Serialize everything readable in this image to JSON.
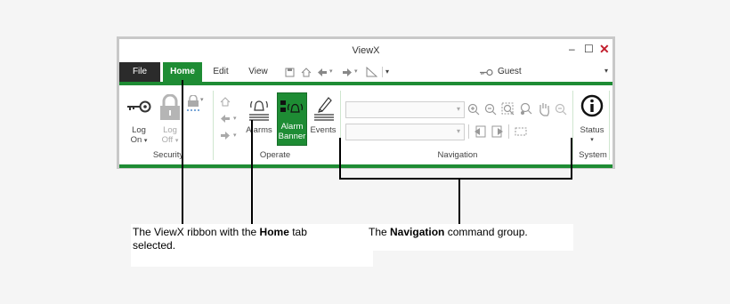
{
  "window": {
    "title": "ViewX",
    "minimize": "–",
    "maximize": "☐",
    "close": "✕"
  },
  "tabs": {
    "file": "File",
    "home": "Home",
    "edit": "Edit",
    "view": "View"
  },
  "user": {
    "name": "Guest",
    "dropdown": "▾"
  },
  "ribbon": {
    "security": {
      "label": "Security",
      "logon_line1": "Log",
      "logon_line2": "On",
      "logoff_line1": "Log",
      "logoff_line2": "Off"
    },
    "operate": {
      "label": "Operate",
      "alarms": "Alarms",
      "alarm_banner_line1": "Alarm",
      "alarm_banner_line2": "Banner",
      "events": "Events"
    },
    "navigation": {
      "label": "Navigation"
    },
    "system": {
      "label": "System",
      "status": "Status"
    }
  },
  "captions": {
    "left_prefix": "The ViewX ribbon with the ",
    "left_bold": "Home",
    "left_suffix": " tab",
    "left_line2": "selected.",
    "right_prefix": "The ",
    "right_bold": "Navigation",
    "right_suffix": " command group."
  },
  "colors": {
    "accent": "#1e8c34",
    "file_tab": "#2b2b2b",
    "close": "#c21e2d"
  }
}
